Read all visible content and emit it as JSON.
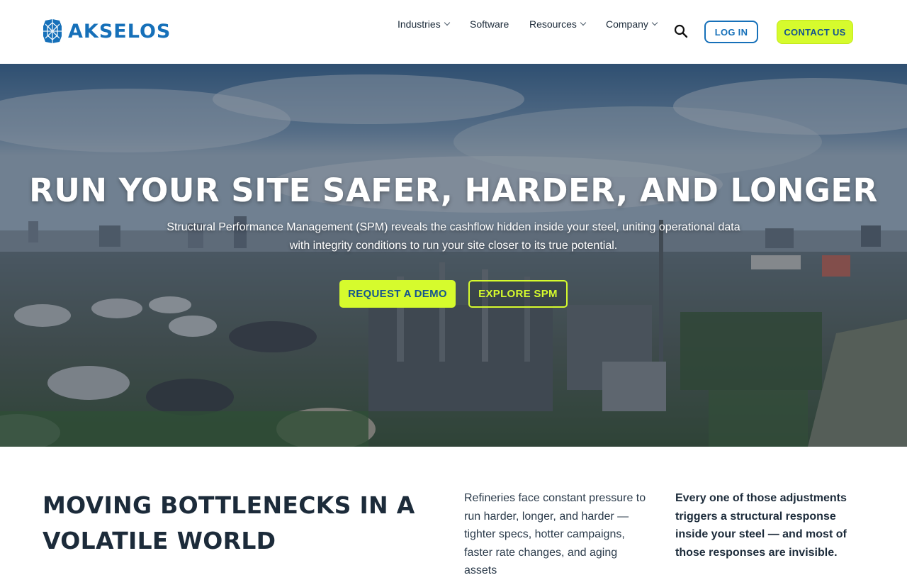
{
  "header": {
    "brand": "AKSELOS",
    "nav": {
      "industries": "Industries",
      "software": "Software",
      "resources": "Resources",
      "company": "Company"
    },
    "login_label": "LOG IN",
    "contact_label": "CONTACT US"
  },
  "hero": {
    "title": "RUN YOUR SITE SAFER, HARDER, AND LONGER",
    "subtitle": "Structural Performance Management (SPM) reveals the cashflow hidden inside your steel, uniting operational data with integrity conditions to run your site closer to its true potential.",
    "primary_cta": "REQUEST A DEMO",
    "secondary_cta": "EXPLORE SPM"
  },
  "section": {
    "title": "MOVING BOTTLENECKS IN A VOLATILE WORLD",
    "paragraph_1": "Refineries face constant pressure to run harder, longer, and harder — tighter specs, hotter campaigns, faster rate changes, and aging assets",
    "paragraph_2": "Every one of those adjustments triggers a structural response inside your steel — and most of those responses are invisible."
  },
  "colors": {
    "brand_blue": "#1670b9",
    "accent_lime": "#d6fb2d",
    "dark_text": "#1c2b3a"
  },
  "icons": {
    "logo": "akselos-logo-mark",
    "search": "search-icon",
    "dropdown": "chevron-down-icon"
  }
}
